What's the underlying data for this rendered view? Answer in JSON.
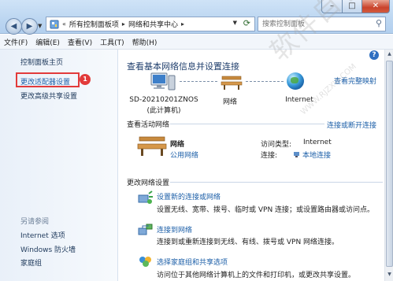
{
  "address": {
    "items": [
      "所有控制面板项",
      "网络和共享中心"
    ]
  },
  "search": {
    "placeholder": "搜索控制面板"
  },
  "menu": [
    "文件(F)",
    "编辑(E)",
    "查看(V)",
    "工具(T)",
    "帮助(H)"
  ],
  "sidebar": {
    "home": "控制面板主页",
    "change_adapter": "更改适配器设置",
    "change_sharing": "更改高级共享设置",
    "badge": "1",
    "see_also": "另请参阅",
    "see_also_items": [
      "Internet 选项",
      "Windows 防火墙",
      "家庭组"
    ]
  },
  "main": {
    "heading": "查看基本网络信息并设置连接",
    "view_full_map": "查看完整映射",
    "computer_name": "SD-20210201ZNOS",
    "computer_sub": "(此计算机)",
    "network_label": "网络",
    "internet_label": "Internet",
    "active_title": "查看活动网络",
    "connect_disconnect": "连接或断开连接",
    "active": {
      "name": "网络",
      "type": "公用网络",
      "access_label": "访问类型:",
      "access_value": "Internet",
      "conn_label": "连接:",
      "conn_value": "本地连接"
    },
    "change_title": "更改网络设置",
    "tasks": [
      {
        "title": "设置新的连接或网络",
        "desc": "设置无线、宽带、拨号、临时或 VPN 连接；或设置路由器或访问点。"
      },
      {
        "title": "连接到网络",
        "desc": "连接到或重新连接到无线、有线、拨号或 VPN 网络连接。"
      },
      {
        "title": "选择家庭组和共享选项",
        "desc": "访问位于其他网络计算机上的文件和打印机，或更改共享设置。"
      }
    ]
  },
  "watermark": {
    "text": "软件自学网",
    "sub": "WWW.RJZXW.COM"
  },
  "colors": {
    "highlight": "#e23b3b",
    "link": "#1c5fa8"
  }
}
